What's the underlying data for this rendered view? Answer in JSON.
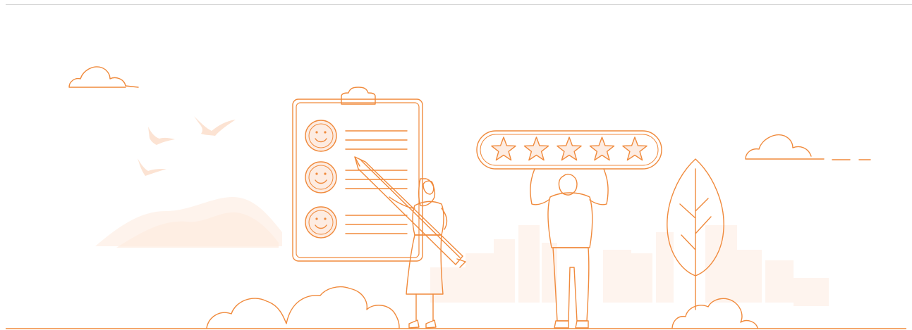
{
  "banner": {
    "theme": "customer feedback / rating illustration",
    "rating": {
      "stars_total": 5,
      "stars_filled": 5
    },
    "survey_rows": 3,
    "colors": {
      "stroke": "#F08A3C",
      "fill_soft": "#FDECE2",
      "fill_faint": "#FEF4EE",
      "divider": "#D6D6D6"
    },
    "icons": [
      "clipboard-icon",
      "smiley-icon",
      "pencil-icon",
      "star-icon",
      "cloud-icon",
      "bird-icon",
      "leaf-icon",
      "bush-icon"
    ]
  }
}
